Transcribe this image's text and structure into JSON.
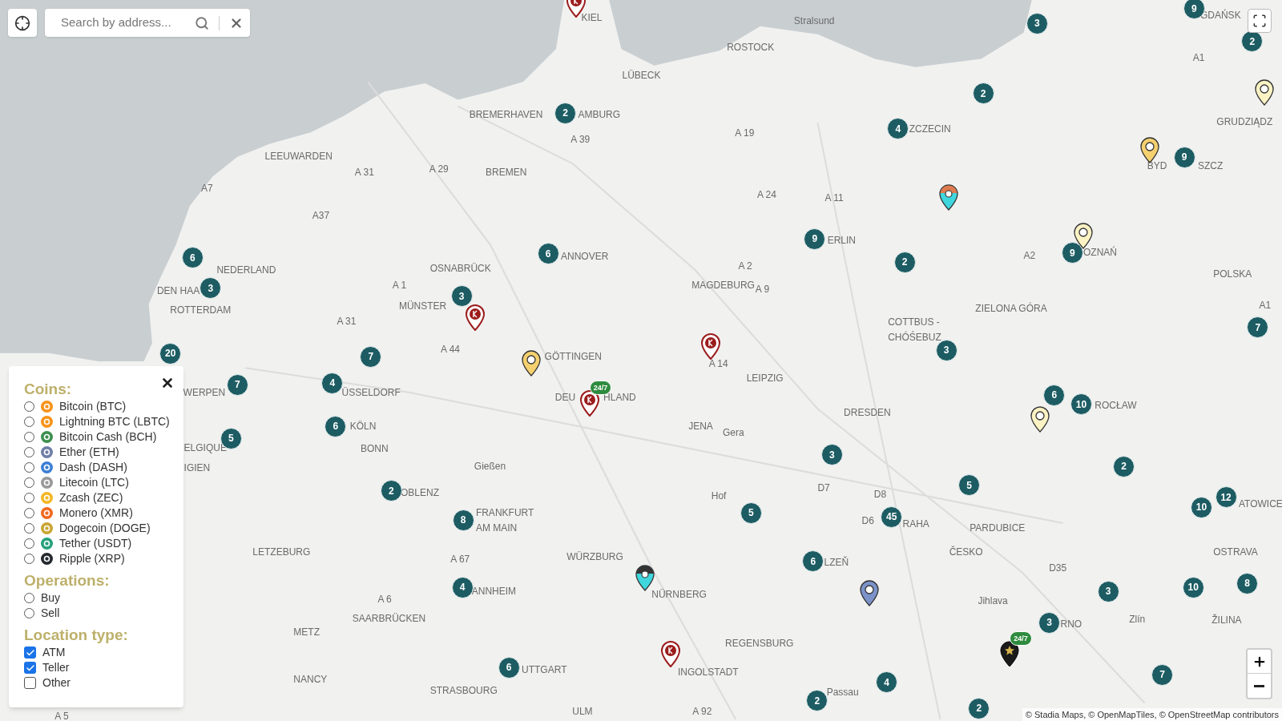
{
  "search": {
    "placeholder": "Search by address..."
  },
  "filters": {
    "sections": [
      {
        "title": "Coins:",
        "kind": "radio",
        "options": [
          {
            "label": "Bitcoin (BTC)",
            "selected": false,
            "color": "#f7931a"
          },
          {
            "label": "Lightning BTC (LBTC)",
            "selected": false,
            "color": "#f7931a"
          },
          {
            "label": "Bitcoin Cash (BCH)",
            "selected": false,
            "color": "#3e8f4f"
          },
          {
            "label": "Ether (ETH)",
            "selected": false,
            "color": "#6f7fa8"
          },
          {
            "label": "Dash (DASH)",
            "selected": false,
            "color": "#3d7fd6"
          },
          {
            "label": "Litecoin (LTC)",
            "selected": false,
            "color": "#999999"
          },
          {
            "label": "Zcash (ZEC)",
            "selected": false,
            "color": "#f4b728"
          },
          {
            "label": "Monero (XMR)",
            "selected": false,
            "color": "#f26822"
          },
          {
            "label": "Dogecoin (DOGE)",
            "selected": false,
            "color": "#c9a633"
          },
          {
            "label": "Tether (USDT)",
            "selected": false,
            "color": "#26a17b"
          },
          {
            "label": "Ripple (XRP)",
            "selected": false,
            "color": "#23292f"
          }
        ]
      },
      {
        "title": "Operations:",
        "kind": "radio",
        "options": [
          {
            "label": "Buy",
            "selected": false
          },
          {
            "label": "Sell",
            "selected": false
          }
        ]
      },
      {
        "title": "Location type:",
        "kind": "checkbox",
        "options": [
          {
            "label": "ATM",
            "checked": true
          },
          {
            "label": "Teller",
            "checked": true
          },
          {
            "label": "Other",
            "checked": false
          }
        ]
      }
    ]
  },
  "map": {
    "labels": [
      "KIEL",
      "Stralsund",
      "GDAŃSK",
      "ROSTOCK",
      "A1",
      "LÜBECK",
      "BREMERHAVEN",
      "AMBURG",
      "GRUDZIĄDZ",
      "A 39",
      "A 19",
      "ZCZECIN",
      "LEEUWARDEN",
      "A 31",
      "A 29",
      "BREMEN",
      "BYD",
      "SZCZ",
      "A7",
      "A 24",
      "A 11",
      "A37",
      "ANNOVER",
      "ERLIN",
      "A2",
      "OZNAŃ",
      "NEDERLAND",
      "OSNABRÜCK",
      "A 2",
      "POLSKA",
      "DEN HAA",
      "A 1",
      "MAGDEBURG",
      "A 9",
      "ROTTERDAM",
      "MÜNSTER",
      "ZIELONA GÓRA",
      "A1",
      "A 31",
      "COTTBUS -",
      "CHÓŚEBUZ",
      "A 44",
      "GÖTTINGEN",
      "A 14",
      "LEIPZIG",
      "WERPEN",
      "ÜSSELDORF",
      "DEU",
      "HLAND",
      "DRESDEN",
      "ROCŁAW",
      "KÖLN",
      "JENA",
      "Gera",
      "ELGIQUE",
      "BONN",
      "IGIEN",
      "Gießen",
      "OBLENZ",
      "Hof",
      "D7",
      "D8",
      "ATOWICE",
      "FRANKFURT",
      "AM MAIN",
      "D6",
      "RAHA",
      "PARDUBICE",
      "LETZEBURG",
      "A 67",
      "WÜRZBURG",
      "LZEŇ",
      "ČESKO",
      "D35",
      "OSTRAVA",
      "A 6",
      "ANNHEIM",
      "NÜRNBERG",
      "Jihlava",
      "SAARBRÜCKEN",
      "RNO",
      "Zlín",
      "ŽILINA",
      "METZ",
      "REGENSBURG",
      "NANCY",
      "UTTGART",
      "INGOLSTADT",
      "STRASBOURG",
      "Passau",
      "A 5",
      "ULM",
      "A 92"
    ],
    "clusters": [
      {
        "count": "3"
      },
      {
        "count": "9"
      },
      {
        "count": "2"
      },
      {
        "count": "2"
      },
      {
        "count": "2"
      },
      {
        "count": "4"
      },
      {
        "count": "9"
      },
      {
        "count": "9"
      },
      {
        "count": "2"
      },
      {
        "count": "9"
      },
      {
        "count": "6"
      },
      {
        "count": "6"
      },
      {
        "count": "3"
      },
      {
        "count": "3"
      },
      {
        "count": "7"
      },
      {
        "count": "7"
      },
      {
        "count": "20"
      },
      {
        "count": "7"
      },
      {
        "count": "4"
      },
      {
        "count": "3"
      },
      {
        "count": "6"
      },
      {
        "count": "10"
      },
      {
        "count": "6"
      },
      {
        "count": "5"
      },
      {
        "count": "3"
      },
      {
        "count": "2"
      },
      {
        "count": "5"
      },
      {
        "count": "2"
      },
      {
        "count": "45"
      },
      {
        "count": "10"
      },
      {
        "count": "12"
      },
      {
        "count": "8"
      },
      {
        "count": "5"
      },
      {
        "count": "6"
      },
      {
        "count": "10"
      },
      {
        "count": "8"
      },
      {
        "count": "3"
      },
      {
        "count": "4"
      },
      {
        "count": "3"
      },
      {
        "count": "7"
      },
      {
        "count": "4"
      },
      {
        "count": "2"
      },
      {
        "count": "2"
      },
      {
        "count": "6"
      }
    ],
    "markers": [
      {
        "kind": "logo",
        "color": "#9b1c1c"
      },
      {
        "kind": "logo",
        "color": "#9b1c1c"
      },
      {
        "kind": "logo",
        "color": "#9b1c1c"
      },
      {
        "kind": "logo",
        "color": "#9b1c1c",
        "badge": "24/7"
      },
      {
        "kind": "logo",
        "color": "#9b1c1c"
      },
      {
        "kind": "plain",
        "color": "#f5d06f"
      },
      {
        "kind": "plain",
        "color": "#f5d06f"
      },
      {
        "kind": "plain",
        "color": "#fbf3c4"
      },
      {
        "kind": "plain",
        "color": "#fbf3c4"
      },
      {
        "kind": "plain",
        "color": "#fbf3c4"
      },
      {
        "kind": "split",
        "color": "#3fd6de",
        "cap": {
          "color": "#e07b4f"
        }
      },
      {
        "kind": "split",
        "color": "#3fd6de",
        "cap": {
          "color": "#333333"
        }
      },
      {
        "kind": "plain",
        "color": "#7b93c9"
      },
      {
        "kind": "star",
        "color": "#1a1a1a",
        "badge": "24/7"
      }
    ]
  },
  "attribution": "© Stadia Maps, © OpenMapTiles, © OpenStreetMap contributors"
}
